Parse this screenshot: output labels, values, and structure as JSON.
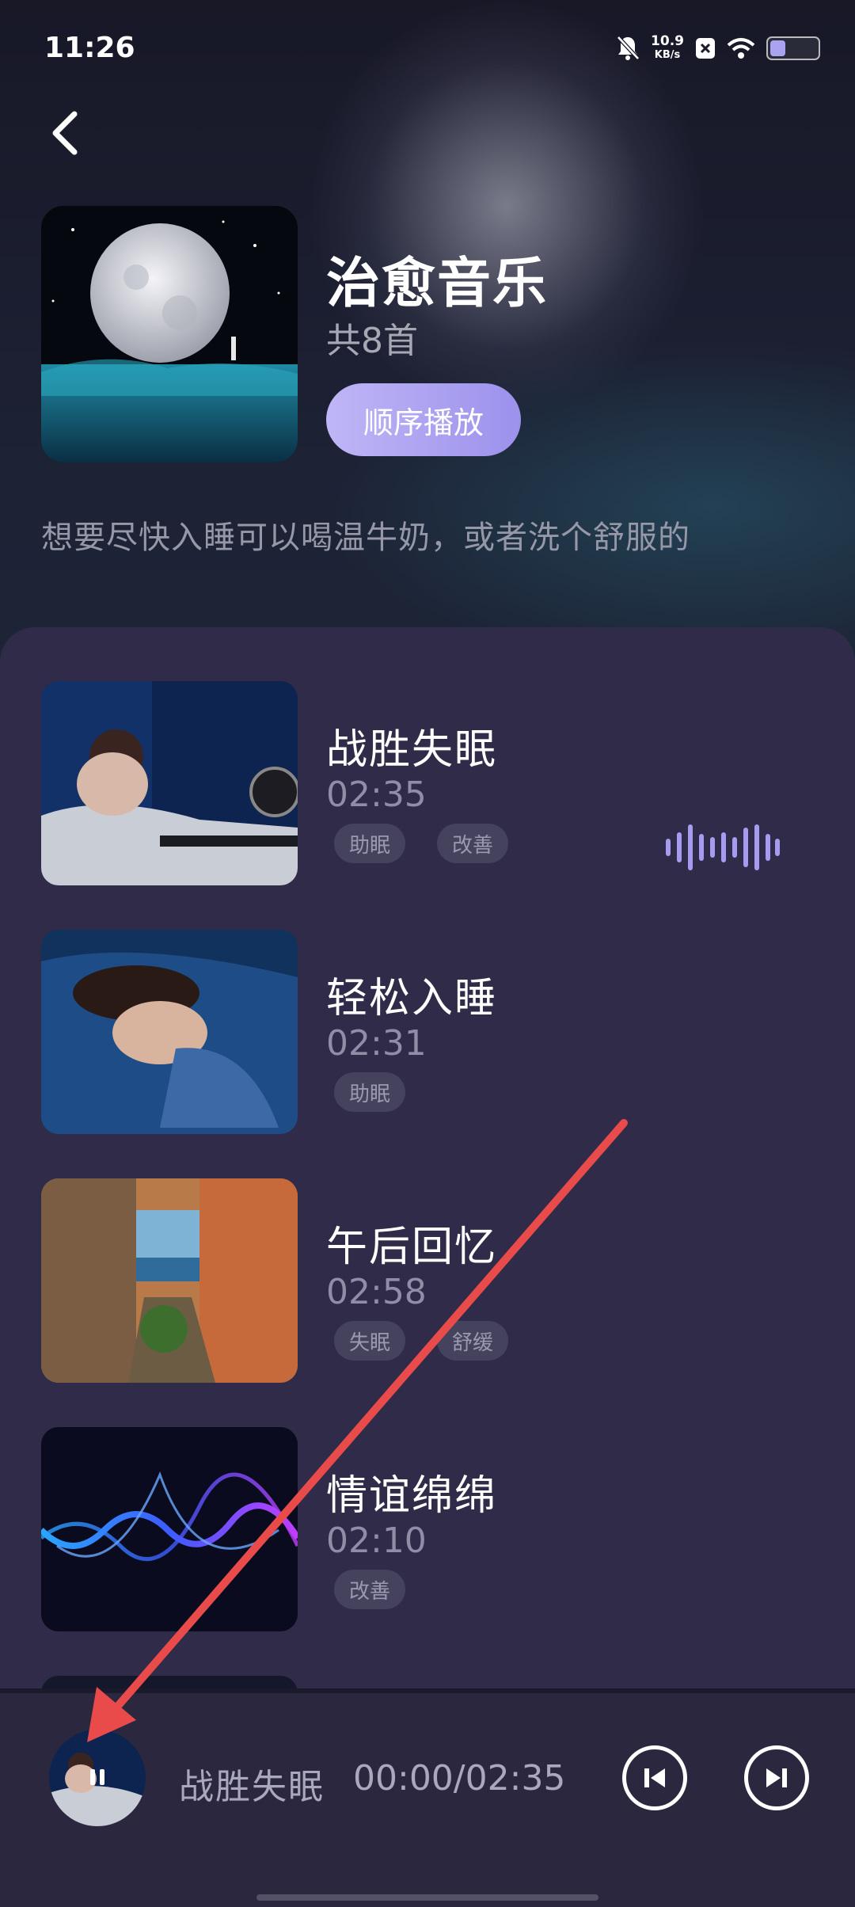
{
  "status_bar": {
    "time": "11:26",
    "net_speed_value": "10.9",
    "net_speed_unit": "KB/s"
  },
  "header": {
    "title": "治愈音乐",
    "count": "共8首",
    "play_button": "顺序播放",
    "description": "想要尽快入睡可以喝温牛奶，或者洗个舒服的"
  },
  "tracks": [
    {
      "name": "战胜失眠",
      "duration": "02:35",
      "tags": [
        "助眠",
        "改善"
      ],
      "playing": true
    },
    {
      "name": "轻松入睡",
      "duration": "02:31",
      "tags": [
        "助眠"
      ]
    },
    {
      "name": "午后回忆",
      "duration": "02:58",
      "tags": [
        "失眠",
        "舒缓"
      ]
    },
    {
      "name": "情谊绵绵",
      "duration": "02:10",
      "tags": [
        "改善"
      ]
    }
  ],
  "player": {
    "name": "战胜失眠",
    "time": "00:00/02:35"
  },
  "colors": {
    "accent": "#a59bf0",
    "panel": "#2f2b48",
    "arrow": "#e94b4b"
  }
}
